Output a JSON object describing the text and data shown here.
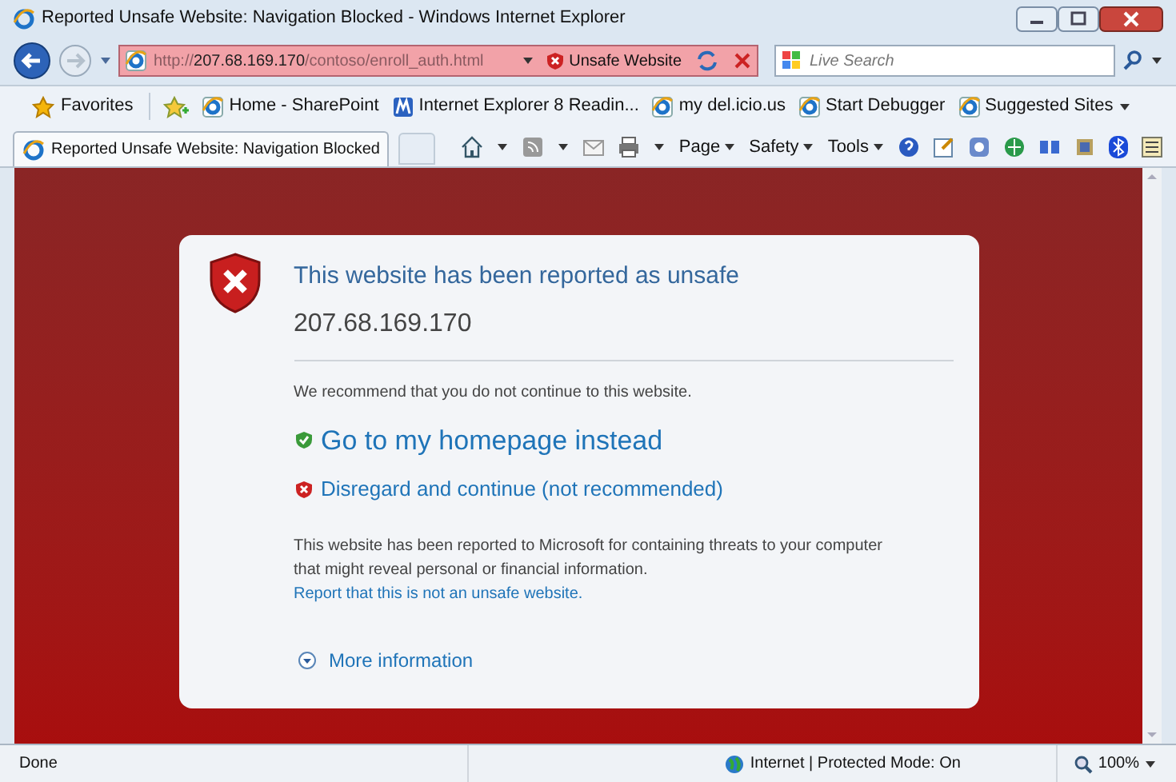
{
  "window": {
    "title": "Reported Unsafe Website: Navigation Blocked - Windows Internet Explorer"
  },
  "address_bar": {
    "scheme": "http://",
    "host": "207.68.169.170",
    "path": "/contoso/enroll_auth.html",
    "status": "Unsafe Website"
  },
  "search": {
    "placeholder": "Live Search"
  },
  "favorites_bar": {
    "label": "Favorites",
    "items": [
      {
        "label": "Home - SharePoint",
        "kind": "page"
      },
      {
        "label": "Internet Explorer 8 Readin...",
        "kind": "reader"
      },
      {
        "label": "my del.icio.us",
        "kind": "page"
      },
      {
        "label": "Start Debugger",
        "kind": "page"
      },
      {
        "label": "Suggested Sites",
        "kind": "menu"
      }
    ]
  },
  "tab": {
    "title": "Reported Unsafe Website: Navigation Blocked"
  },
  "command_bar": {
    "menus": [
      "Page",
      "Safety",
      "Tools"
    ]
  },
  "warning": {
    "title": "This website has been reported as unsafe",
    "host": "207.68.169.170",
    "advice": "We recommend that you do not continue to this website.",
    "options": [
      {
        "kind": "safe",
        "label": "Go to my homepage instead"
      },
      {
        "kind": "unsafe",
        "label": "Disregard and continue (not recommended)"
      }
    ],
    "explanation": "This website has been reported to Microsoft for containing threats to your computer that might reveal personal or financial information.",
    "report_link": "Report that this is not an unsafe website.",
    "more": "More information"
  },
  "status_bar": {
    "text": "Done",
    "zone": "Internet | Protected Mode: On",
    "zoom": "100%"
  }
}
